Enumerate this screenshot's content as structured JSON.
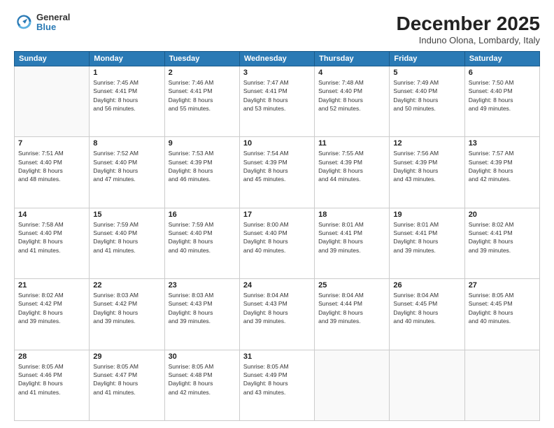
{
  "logo": {
    "general": "General",
    "blue": "Blue"
  },
  "header": {
    "month": "December 2025",
    "location": "Induno Olona, Lombardy, Italy"
  },
  "weekdays": [
    "Sunday",
    "Monday",
    "Tuesday",
    "Wednesday",
    "Thursday",
    "Friday",
    "Saturday"
  ],
  "weeks": [
    [
      {
        "day": "",
        "info": ""
      },
      {
        "day": "1",
        "info": "Sunrise: 7:45 AM\nSunset: 4:41 PM\nDaylight: 8 hours\nand 56 minutes."
      },
      {
        "day": "2",
        "info": "Sunrise: 7:46 AM\nSunset: 4:41 PM\nDaylight: 8 hours\nand 55 minutes."
      },
      {
        "day": "3",
        "info": "Sunrise: 7:47 AM\nSunset: 4:41 PM\nDaylight: 8 hours\nand 53 minutes."
      },
      {
        "day": "4",
        "info": "Sunrise: 7:48 AM\nSunset: 4:40 PM\nDaylight: 8 hours\nand 52 minutes."
      },
      {
        "day": "5",
        "info": "Sunrise: 7:49 AM\nSunset: 4:40 PM\nDaylight: 8 hours\nand 50 minutes."
      },
      {
        "day": "6",
        "info": "Sunrise: 7:50 AM\nSunset: 4:40 PM\nDaylight: 8 hours\nand 49 minutes."
      }
    ],
    [
      {
        "day": "7",
        "info": "Sunrise: 7:51 AM\nSunset: 4:40 PM\nDaylight: 8 hours\nand 48 minutes."
      },
      {
        "day": "8",
        "info": "Sunrise: 7:52 AM\nSunset: 4:40 PM\nDaylight: 8 hours\nand 47 minutes."
      },
      {
        "day": "9",
        "info": "Sunrise: 7:53 AM\nSunset: 4:39 PM\nDaylight: 8 hours\nand 46 minutes."
      },
      {
        "day": "10",
        "info": "Sunrise: 7:54 AM\nSunset: 4:39 PM\nDaylight: 8 hours\nand 45 minutes."
      },
      {
        "day": "11",
        "info": "Sunrise: 7:55 AM\nSunset: 4:39 PM\nDaylight: 8 hours\nand 44 minutes."
      },
      {
        "day": "12",
        "info": "Sunrise: 7:56 AM\nSunset: 4:39 PM\nDaylight: 8 hours\nand 43 minutes."
      },
      {
        "day": "13",
        "info": "Sunrise: 7:57 AM\nSunset: 4:39 PM\nDaylight: 8 hours\nand 42 minutes."
      }
    ],
    [
      {
        "day": "14",
        "info": "Sunrise: 7:58 AM\nSunset: 4:40 PM\nDaylight: 8 hours\nand 41 minutes."
      },
      {
        "day": "15",
        "info": "Sunrise: 7:59 AM\nSunset: 4:40 PM\nDaylight: 8 hours\nand 41 minutes."
      },
      {
        "day": "16",
        "info": "Sunrise: 7:59 AM\nSunset: 4:40 PM\nDaylight: 8 hours\nand 40 minutes."
      },
      {
        "day": "17",
        "info": "Sunrise: 8:00 AM\nSunset: 4:40 PM\nDaylight: 8 hours\nand 40 minutes."
      },
      {
        "day": "18",
        "info": "Sunrise: 8:01 AM\nSunset: 4:41 PM\nDaylight: 8 hours\nand 39 minutes."
      },
      {
        "day": "19",
        "info": "Sunrise: 8:01 AM\nSunset: 4:41 PM\nDaylight: 8 hours\nand 39 minutes."
      },
      {
        "day": "20",
        "info": "Sunrise: 8:02 AM\nSunset: 4:41 PM\nDaylight: 8 hours\nand 39 minutes."
      }
    ],
    [
      {
        "day": "21",
        "info": "Sunrise: 8:02 AM\nSunset: 4:42 PM\nDaylight: 8 hours\nand 39 minutes."
      },
      {
        "day": "22",
        "info": "Sunrise: 8:03 AM\nSunset: 4:42 PM\nDaylight: 8 hours\nand 39 minutes."
      },
      {
        "day": "23",
        "info": "Sunrise: 8:03 AM\nSunset: 4:43 PM\nDaylight: 8 hours\nand 39 minutes."
      },
      {
        "day": "24",
        "info": "Sunrise: 8:04 AM\nSunset: 4:43 PM\nDaylight: 8 hours\nand 39 minutes."
      },
      {
        "day": "25",
        "info": "Sunrise: 8:04 AM\nSunset: 4:44 PM\nDaylight: 8 hours\nand 39 minutes."
      },
      {
        "day": "26",
        "info": "Sunrise: 8:04 AM\nSunset: 4:45 PM\nDaylight: 8 hours\nand 40 minutes."
      },
      {
        "day": "27",
        "info": "Sunrise: 8:05 AM\nSunset: 4:45 PM\nDaylight: 8 hours\nand 40 minutes."
      }
    ],
    [
      {
        "day": "28",
        "info": "Sunrise: 8:05 AM\nSunset: 4:46 PM\nDaylight: 8 hours\nand 41 minutes."
      },
      {
        "day": "29",
        "info": "Sunrise: 8:05 AM\nSunset: 4:47 PM\nDaylight: 8 hours\nand 41 minutes."
      },
      {
        "day": "30",
        "info": "Sunrise: 8:05 AM\nSunset: 4:48 PM\nDaylight: 8 hours\nand 42 minutes."
      },
      {
        "day": "31",
        "info": "Sunrise: 8:05 AM\nSunset: 4:49 PM\nDaylight: 8 hours\nand 43 minutes."
      },
      {
        "day": "",
        "info": ""
      },
      {
        "day": "",
        "info": ""
      },
      {
        "day": "",
        "info": ""
      }
    ]
  ]
}
